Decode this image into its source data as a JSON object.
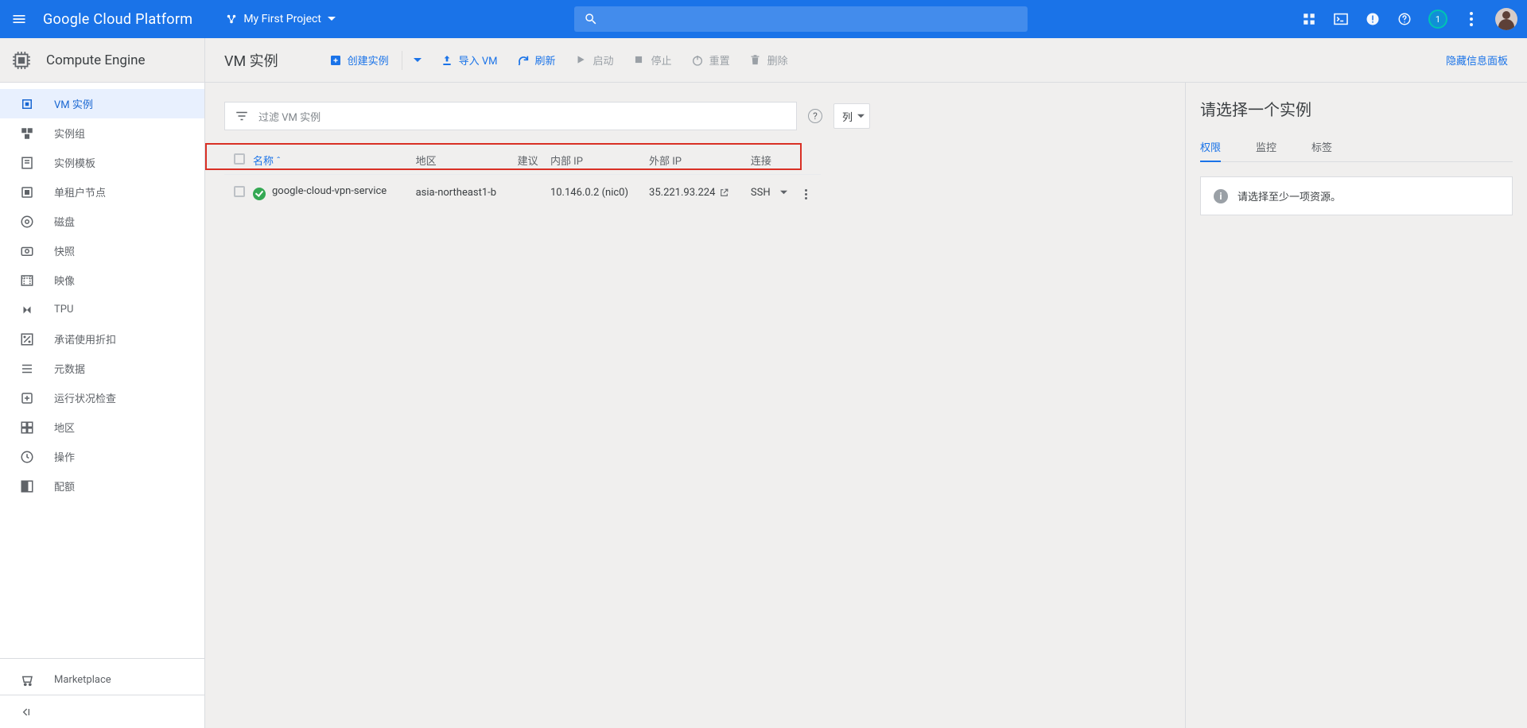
{
  "topbar": {
    "product": "Google Cloud Platform",
    "project": "My First Project",
    "notification_count": "1"
  },
  "section": {
    "title": "Compute Engine"
  },
  "sidebar": {
    "items": [
      {
        "label": "VM 实例",
        "active": true
      },
      {
        "label": "实例组"
      },
      {
        "label": "实例模板"
      },
      {
        "label": "单租户节点"
      },
      {
        "label": "磁盘"
      },
      {
        "label": "快照"
      },
      {
        "label": "映像"
      },
      {
        "label": "TPU"
      },
      {
        "label": "承诺使用折扣"
      },
      {
        "label": "元数据"
      },
      {
        "label": "运行状况检查"
      },
      {
        "label": "地区"
      },
      {
        "label": "操作"
      },
      {
        "label": "配额"
      }
    ],
    "marketplace": "Marketplace"
  },
  "actions": {
    "page_title": "VM 实例",
    "create": "创建实例",
    "import": "导入 VM",
    "refresh": "刷新",
    "start": "启动",
    "stop": "停止",
    "reset": "重置",
    "delete": "删除",
    "hide_panel": "隐藏信息面板"
  },
  "filter": {
    "placeholder": "过滤 VM 实例",
    "columns_label": "列"
  },
  "table": {
    "headers": {
      "name": "名称",
      "zone": "地区",
      "recommendation": "建议",
      "internal_ip": "内部 IP",
      "external_ip": "外部 IP",
      "connect": "连接"
    },
    "rows": [
      {
        "name": "google-cloud-vpn-service",
        "zone": "asia-northeast1-b",
        "recommendation": "",
        "internal_ip": "10.146.0.2 (nic0)",
        "external_ip": "35.221.93.224",
        "connect": "SSH"
      }
    ]
  },
  "right_panel": {
    "title": "请选择一个实例",
    "tabs": {
      "permissions": "权限",
      "monitoring": "监控",
      "labels": "标签"
    },
    "message": "请选择至少一项资源。"
  }
}
